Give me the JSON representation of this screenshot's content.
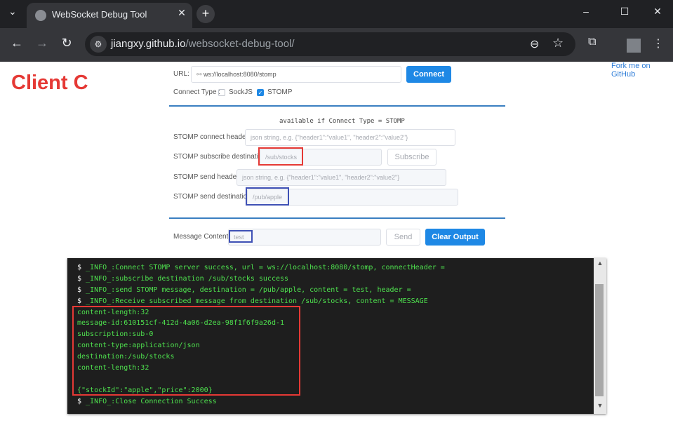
{
  "browser": {
    "tab_title": "WebSocket Debug Tool",
    "tab_close": "✕",
    "tab_menu": "⌄",
    "new_tab": "+",
    "url_host": "jiangxy.github.io",
    "url_path": "/websocket-debug-tool/",
    "site_info": "⚙",
    "window_controls": [
      "–",
      "☐",
      "✕"
    ],
    "nav": {
      "back": "←",
      "forward": "→",
      "reload": "↻"
    },
    "zoom_icon": "⊖",
    "star_icon": "☆",
    "ext_icon": "⧉",
    "menu_icon": "⋮"
  },
  "page": {
    "client_label": "Client C",
    "fork_link": "Fork me on GitHub",
    "url_label": "URL:",
    "url_value": "ws://localhost:8080/stomp",
    "connect_button": "Connect",
    "connect_type_label": "Connect Type :",
    "sockjs_label": "SockJS",
    "stomp_label": "STOMP",
    "sockjs_checked": false,
    "stomp_checked": true,
    "available_note": "available if Connect Type = STOMP",
    "stomp_connect_header_label": "STOMP connect header :",
    "stomp_connect_header_placeholder": "json string, e.g. {\"header1\":\"value1\", \"header2\":\"value2\"}",
    "stomp_subscribe_dest_label": "STOMP subscribe destination :",
    "stomp_subscribe_dest_value": "/sub/stocks",
    "subscribe_button": "Subscribe",
    "stomp_send_header_label": "STOMP send header :",
    "stomp_send_header_placeholder": "json string, e.g. {\"header1\":\"value1\", \"header2\":\"value2\"}",
    "stomp_send_dest_label": "STOMP send destination :",
    "stomp_send_dest_value": "/pub/apple",
    "message_content_label": "Message Content :",
    "message_content_value": "test",
    "send_button": "Send",
    "clear_output_button": "Clear Output"
  },
  "console": {
    "prompt": "$ ",
    "lines": [
      {
        "prompt": true,
        "text": "_INFO_:Connect STOMP server success, url = ws://localhost:8080/stomp, connectHeader ="
      },
      {
        "prompt": true,
        "text": "_INFO_:subscribe destination /sub/stocks success"
      },
      {
        "prompt": true,
        "text": "_INFO_:send STOMP message, destination = /pub/apple, content = test, header ="
      },
      {
        "prompt": true,
        "text": "_INFO_:Receive subscribed message from destination /sub/stocks, content = MESSAGE"
      },
      {
        "prompt": false,
        "text": "content-length:32"
      },
      {
        "prompt": false,
        "text": "message-id:610151cf-412d-4a06-d2ea-98f1f6f9a26d-1"
      },
      {
        "prompt": false,
        "text": "subscription:sub-0"
      },
      {
        "prompt": false,
        "text": "content-type:application/json"
      },
      {
        "prompt": false,
        "text": "destination:/sub/stocks"
      },
      {
        "prompt": false,
        "text": "content-length:32"
      },
      {
        "prompt": false,
        "text": ""
      },
      {
        "prompt": false,
        "text": "{\"stockId\":\"apple\",\"price\":2000}"
      },
      {
        "prompt": true,
        "text": "_INFO_:Close Connection Success"
      }
    ],
    "scroll_up": "▲",
    "scroll_down": "▼"
  }
}
